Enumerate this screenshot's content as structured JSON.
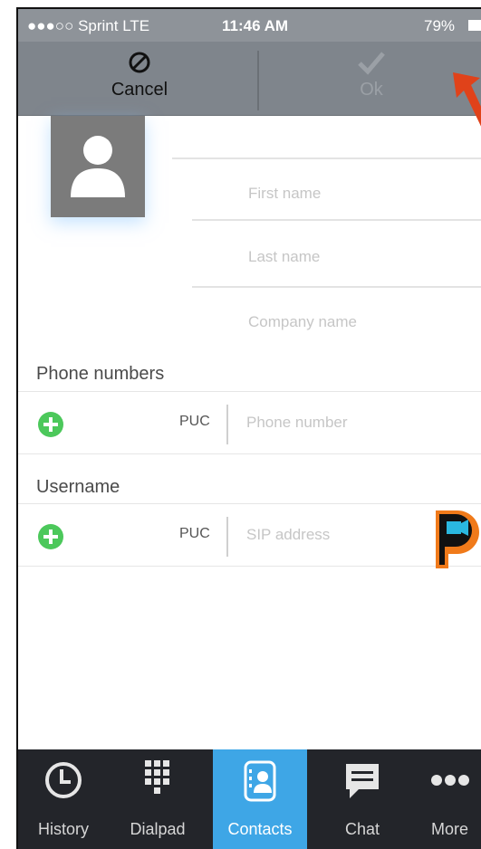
{
  "status_bar": {
    "carrier": "●●●○○ Sprint  LTE",
    "time": "11:46 AM",
    "battery": "79%"
  },
  "toolbar": {
    "cancel_label": "Cancel",
    "ok_label": "Ok"
  },
  "form": {
    "first_name_placeholder": "First name",
    "last_name_placeholder": "Last name",
    "company_placeholder": "Company name"
  },
  "phone_section": {
    "label": "Phone numbers",
    "type": "PUC",
    "placeholder": "Phone number"
  },
  "username_section": {
    "label": "Username",
    "type": "PUC",
    "placeholder": "SIP address"
  },
  "tabs": [
    {
      "label": "History",
      "icon": "history-icon",
      "active": false
    },
    {
      "label": "Dialpad",
      "icon": "dialpad-icon",
      "active": false
    },
    {
      "label": "Contacts",
      "icon": "contacts-icon",
      "active": true
    },
    {
      "label": "Chat",
      "icon": "chat-icon",
      "active": false
    },
    {
      "label": "More",
      "icon": "more-icon",
      "active": false
    }
  ],
  "colors": {
    "accent": "#3ea6e6",
    "toolbar": "#7f858c",
    "add_green": "#4cc85b",
    "tab_bar": "#23252a",
    "arrow": "#e0421a"
  }
}
